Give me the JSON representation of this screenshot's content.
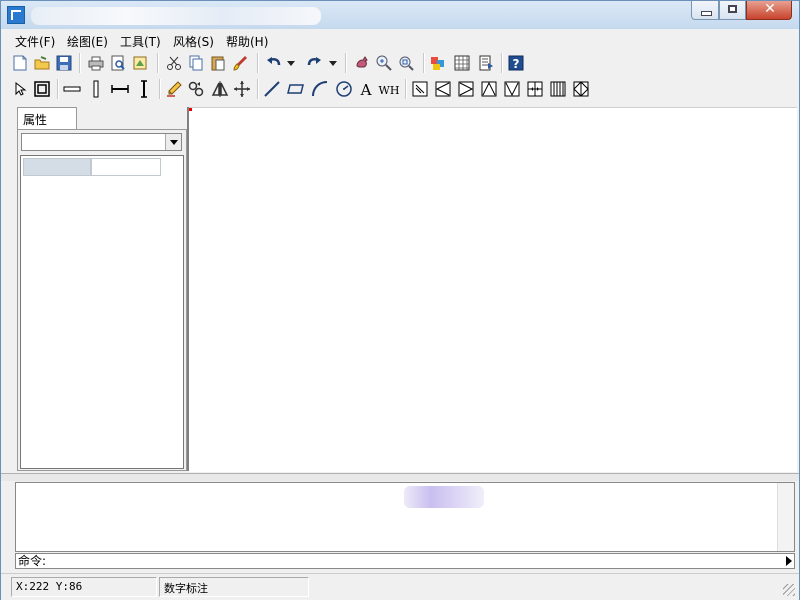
{
  "menu": {
    "file": "文件(F)",
    "draw": "绘图(E)",
    "tools": "工具(T)",
    "style": "风格(S)",
    "help": "帮助(H)"
  },
  "toolbar_icons_row1": [
    "new-icon",
    "open-icon",
    "save-icon",
    "print-icon",
    "print-preview-icon",
    "export-icon",
    "cut-icon",
    "copy-icon",
    "paste-icon",
    "brush-icon",
    "undo-icon",
    "undo-dropdown-icon",
    "redo-icon",
    "redo-dropdown-icon",
    "pan-icon",
    "zoom-in-icon",
    "zoom-window-icon",
    "layer-color-icon",
    "grid-icon",
    "properties-icon",
    "help-icon"
  ],
  "toolbar_icons_row2": [
    "select-arrow-icon",
    "rectangle-select-icon",
    "horizontal-wall-icon",
    "vertical-wall-icon",
    "horizontal-dimension-icon",
    "vertical-dimension-icon",
    "pencil-icon",
    "rotate-icon",
    "mirror-icon",
    "move-icon",
    "line-icon",
    "rectangle-icon",
    "arc-icon",
    "circle-icon",
    "text-icon",
    "wh-icon",
    "shape-1-icon",
    "shape-2-icon",
    "shape-3-icon",
    "shape-4-icon",
    "shape-5-icon",
    "shape-6-icon",
    "shape-7-icon",
    "shape-8-icon"
  ],
  "toolbar_text": {
    "text_tool": "A",
    "wh_tool": "WH"
  },
  "panel": {
    "tab_label": "属性",
    "combo_value": ""
  },
  "command": {
    "prompt": "命令:"
  },
  "status": {
    "coords": "X:222  Y:86",
    "mode": "数字标注"
  }
}
